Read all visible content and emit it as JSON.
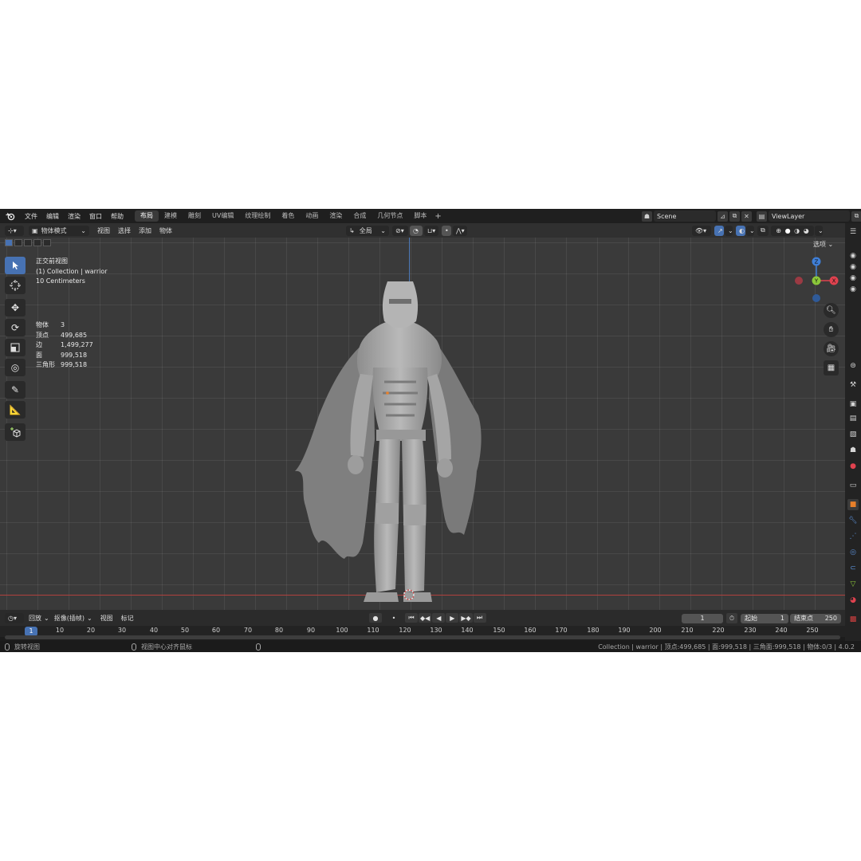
{
  "menu": {
    "items": [
      "文件",
      "编辑",
      "渲染",
      "窗口",
      "帮助"
    ],
    "workspaces": [
      "布局",
      "建模",
      "雕刻",
      "UV编辑",
      "纹理绘制",
      "着色",
      "动画",
      "渲染",
      "合成",
      "几何节点",
      "脚本"
    ],
    "active_workspace_index": 0,
    "add_tab": "+",
    "scene": "Scene",
    "view_layer": "ViewLayer"
  },
  "viewport_header": {
    "mode": "物体模式",
    "menus": [
      "视图",
      "选择",
      "添加",
      "物体"
    ],
    "transform_orientation": "全局",
    "options": "选项"
  },
  "overlay": {
    "view_name": "正交前视图",
    "collection": "(1) Collection | warrior",
    "scale": "10 Centimeters"
  },
  "stats": [
    {
      "label": "物体",
      "value": "3"
    },
    {
      "label": "顶点",
      "value": "499,685"
    },
    {
      "label": "边",
      "value": "1,499,277"
    },
    {
      "label": "面",
      "value": "999,518"
    },
    {
      "label": "三角形",
      "value": "999,518"
    }
  ],
  "gizmo": {
    "z": "Z",
    "y": "Y",
    "x": "X"
  },
  "timeline": {
    "menus": [
      "回放",
      "抠像(插帧)",
      "视图",
      "标记"
    ],
    "current_frame": "1",
    "start_label": "起始",
    "start": "1",
    "end_label": "结束点",
    "end": "250",
    "ruler": [
      "10",
      "20",
      "30",
      "40",
      "50",
      "60",
      "70",
      "80",
      "90",
      "100",
      "110",
      "120",
      "130",
      "140",
      "150",
      "160",
      "170",
      "180",
      "190",
      "200",
      "210",
      "220",
      "230",
      "240",
      "250"
    ],
    "ruler_current": "1"
  },
  "status": {
    "left": "旋转视图",
    "middle": "视图中心对齐鼠标",
    "right": "Collection | warrior | 顶点:499,685 | 面:999,518 | 三角面:999,518 | 物体:0/3 | 4.0.2"
  },
  "colors": {
    "accent": "#4772b3",
    "x_axis": "#e0424f",
    "y_axis": "#8bc73a",
    "z_axis": "#3f7fd8",
    "object_orange": "#e8802a"
  },
  "icons": {
    "logo": "blender-logo-icon",
    "tools": [
      "select-box-icon",
      "cursor-icon",
      "move-icon",
      "rotate-icon",
      "scale-icon",
      "transform-icon",
      "annotate-icon",
      "measure-icon",
      "add-cube-icon"
    ],
    "nav": [
      "zoom-icon",
      "hand-pan-icon",
      "camera-icon",
      "grid-toggle-icon"
    ]
  }
}
